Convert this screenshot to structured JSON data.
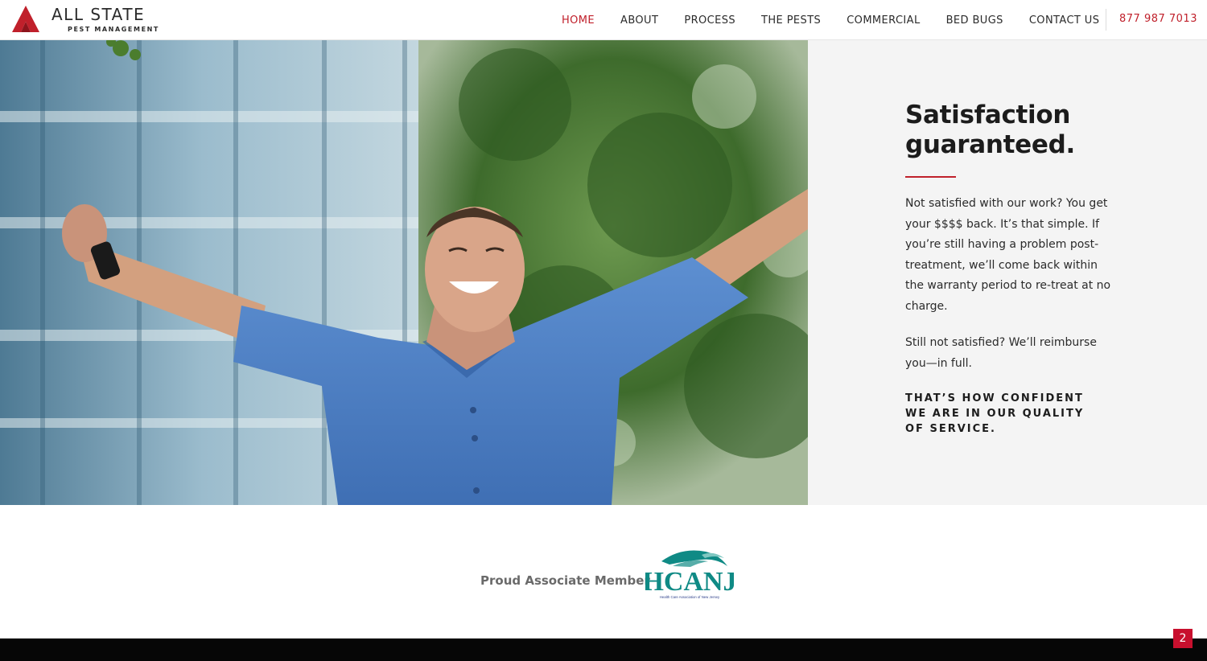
{
  "brand": {
    "name": "ALL STATE",
    "tagline": "PEST MANAGEMENT",
    "accent": "#c0202b"
  },
  "nav": {
    "items": [
      {
        "label": "HOME",
        "active": true
      },
      {
        "label": "ABOUT",
        "active": false
      },
      {
        "label": "PROCESS",
        "active": false
      },
      {
        "label": "THE PESTS",
        "active": false
      },
      {
        "label": "COMMERCIAL",
        "active": false
      },
      {
        "label": "BED BUGS",
        "active": false
      },
      {
        "label": "CONTACT US",
        "active": false
      }
    ],
    "phone": "877 987 7013"
  },
  "hero": {
    "image": "man-with-arms-raised-photo"
  },
  "satisfaction": {
    "title": "Satisfaction guaranteed.",
    "paragraph1": "Not satisfied with our work? You get your $$$$ back. It’s that simple. If you’re still having a problem post-treatment, we’ll come back within the warranty period to re-treat at no charge.",
    "paragraph2": "Still not satisfied? We’ll reimburse you—in full.",
    "closing": "THAT’S HOW CONFIDENT WE ARE IN OUR QUALITY OF SERVICE."
  },
  "membership": {
    "label": "Proud Associate Member",
    "logo_text": "HCANJ",
    "logo_subtext": "Health Care Association of New Jersey"
  },
  "badge": {
    "count": "2",
    "color": "#c8102e"
  }
}
